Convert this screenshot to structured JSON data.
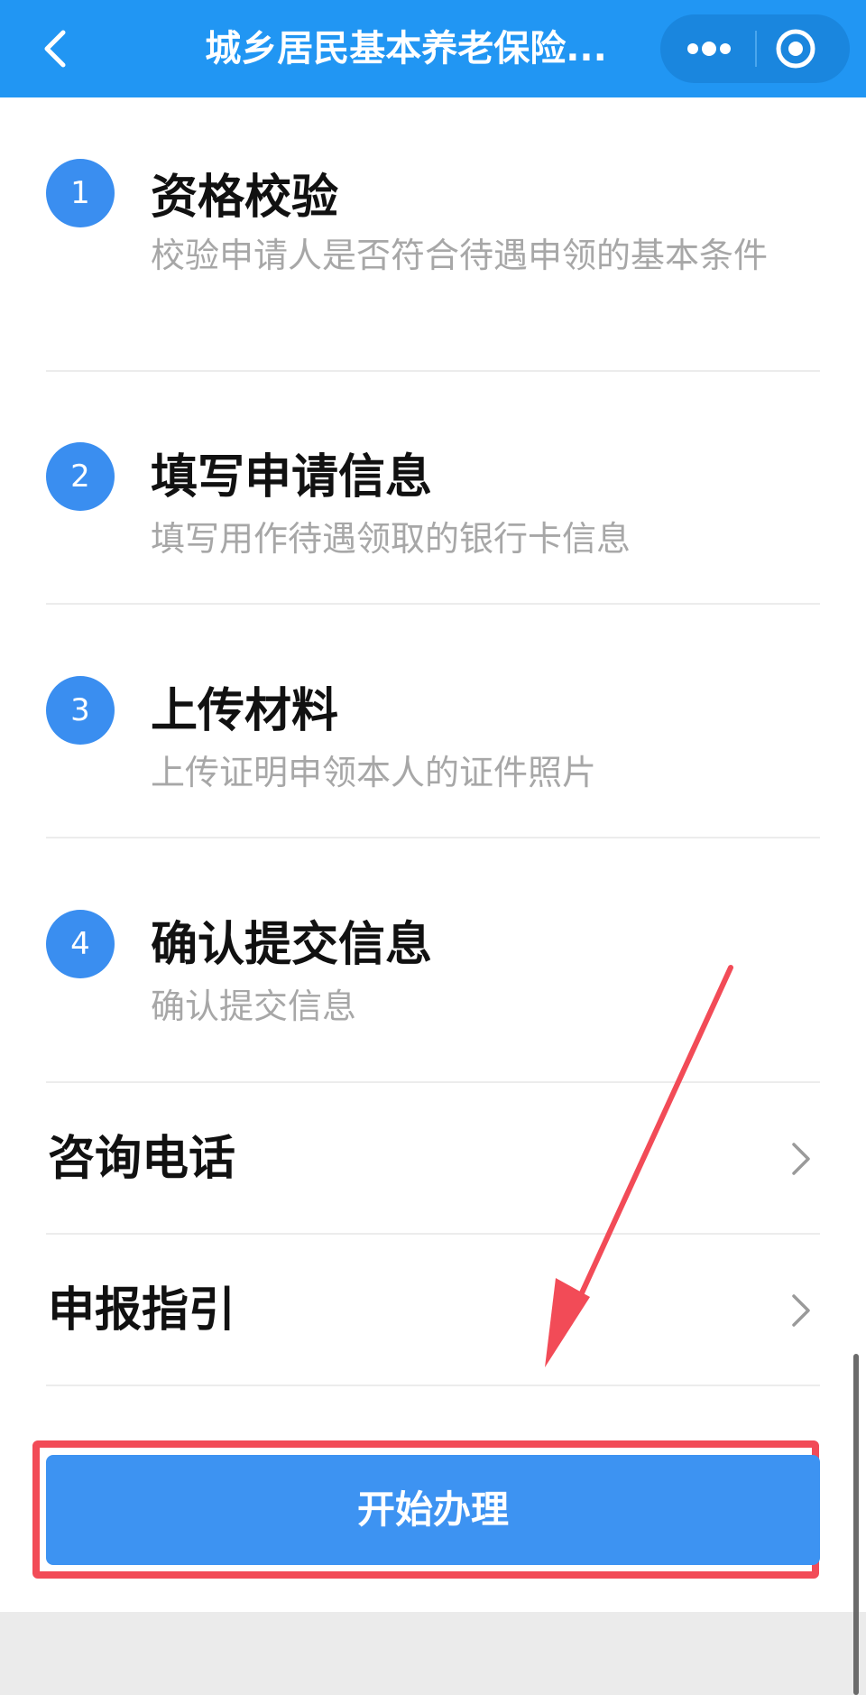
{
  "header": {
    "title": "城乡居民基本养老保险..."
  },
  "steps": [
    {
      "number": "1",
      "title": "资格校验",
      "desc": "校验申请人是否符合待遇申领的基本条件"
    },
    {
      "number": "2",
      "title": "填写申请信息",
      "desc": "填写用作待遇领取的银行卡信息"
    },
    {
      "number": "3",
      "title": "上传材料",
      "desc": "上传证明申领本人的证件照片"
    },
    {
      "number": "4",
      "title": "确认提交信息",
      "desc": "确认提交信息"
    }
  ],
  "links": [
    {
      "label": "咨询电话"
    },
    {
      "label": "申报指引"
    }
  ],
  "start_button": {
    "label": "开始办理"
  },
  "colors": {
    "header": "#2196f3",
    "step_badge": "#3a8ef0",
    "primary_button": "#3d93f2",
    "highlight_annotation": "#f24b57"
  }
}
